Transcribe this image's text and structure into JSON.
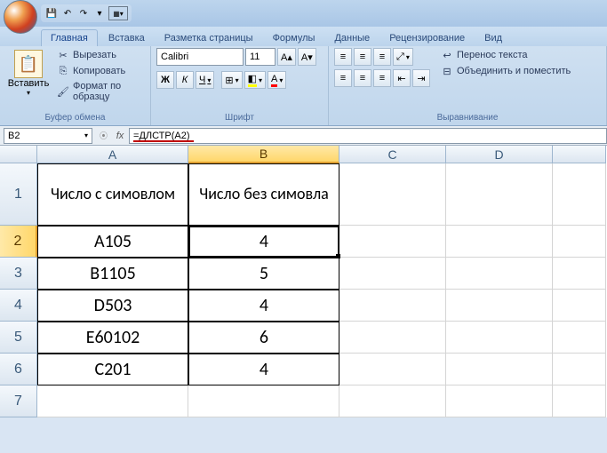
{
  "qat": {
    "save": "💾",
    "undo": "↶",
    "redo": "↷"
  },
  "tabs": [
    "Главная",
    "Вставка",
    "Разметка страницы",
    "Формулы",
    "Данные",
    "Рецензирование",
    "Вид"
  ],
  "active_tab": 0,
  "ribbon": {
    "clipboard": {
      "paste": "Вставить",
      "cut": "Вырезать",
      "copy": "Копировать",
      "format_painter": "Формат по образцу",
      "label": "Буфер обмена"
    },
    "font": {
      "name": "Calibri",
      "size": "11",
      "label": "Шрифт",
      "bold": "Ж",
      "italic": "К",
      "underline": "Ч"
    },
    "alignment": {
      "wrap": "Перенос текста",
      "merge": "Объединить и поместить",
      "label": "Выравнивание"
    }
  },
  "name_box": "B2",
  "formula": "=ДЛСТР(A2)",
  "columns": [
    "A",
    "B",
    "C",
    "D"
  ],
  "rows": [
    "1",
    "2",
    "3",
    "4",
    "5",
    "6",
    "7"
  ],
  "cells": {
    "A1": "Число с симовлом",
    "B1": "Число без симовла",
    "A2": "А105",
    "B2": "4",
    "A3": "В1105",
    "B3": "5",
    "A4": "D503",
    "B4": "4",
    "A5": "E60102",
    "B5": "6",
    "A6": "C201",
    "B6": "4"
  },
  "selected_cell": "B2"
}
